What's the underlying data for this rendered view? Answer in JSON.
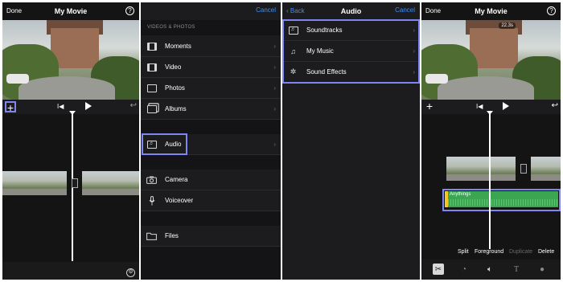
{
  "panel1": {
    "nav": {
      "left": "Done",
      "title": "My Movie",
      "help_icon": "?"
    },
    "controls": {
      "add_icon": "+",
      "skip_icon": "I◀",
      "undo_icon": "↩"
    },
    "settings_icon": "⚙"
  },
  "panel2": {
    "nav": {
      "right": "Cancel"
    },
    "section_header": "VIDEOS & PHOTOS",
    "items": [
      {
        "label": "Moments",
        "icon": "film-icon"
      },
      {
        "label": "Video",
        "icon": "film-icon"
      },
      {
        "label": "Photos",
        "icon": "photo-icon"
      },
      {
        "label": "Albums",
        "icon": "album-icon"
      },
      {
        "label": "Audio",
        "icon": "music-note-icon"
      },
      {
        "label": "Camera",
        "icon": "camera-icon"
      },
      {
        "label": "Voiceover",
        "icon": "microphone-icon"
      },
      {
        "label": "Files",
        "icon": "folder-icon"
      }
    ],
    "chevron": "›"
  },
  "panel3": {
    "nav": {
      "left": "Back",
      "title": "Audio",
      "right": "Cancel"
    },
    "items": [
      {
        "label": "Soundtracks",
        "icon": "soundtrack-icon"
      },
      {
        "label": "My Music",
        "icon": "music-note-icon"
      },
      {
        "label": "Sound Effects",
        "icon": "sparkle-icon"
      }
    ],
    "chevron": "›"
  },
  "panel4": {
    "nav": {
      "left": "Done",
      "title": "My Movie",
      "help_icon": "?"
    },
    "time_badge": "22.3s",
    "controls": {
      "add_icon": "+",
      "skip_icon": "I◀",
      "undo_icon": "↩"
    },
    "audio_clip_label": "Anythings",
    "actions": [
      "Split",
      "Foreground",
      "Duplicate",
      "Delete"
    ],
    "tools": [
      "scissors-icon",
      "speed-icon",
      "volume-icon",
      "title-icon",
      "filter-icon"
    ],
    "colors": {
      "highlight": "#7f86f2",
      "accent": "#3d8ef8",
      "audio_clip": "#3aa651",
      "audio_handle": "#f4c81f"
    }
  }
}
